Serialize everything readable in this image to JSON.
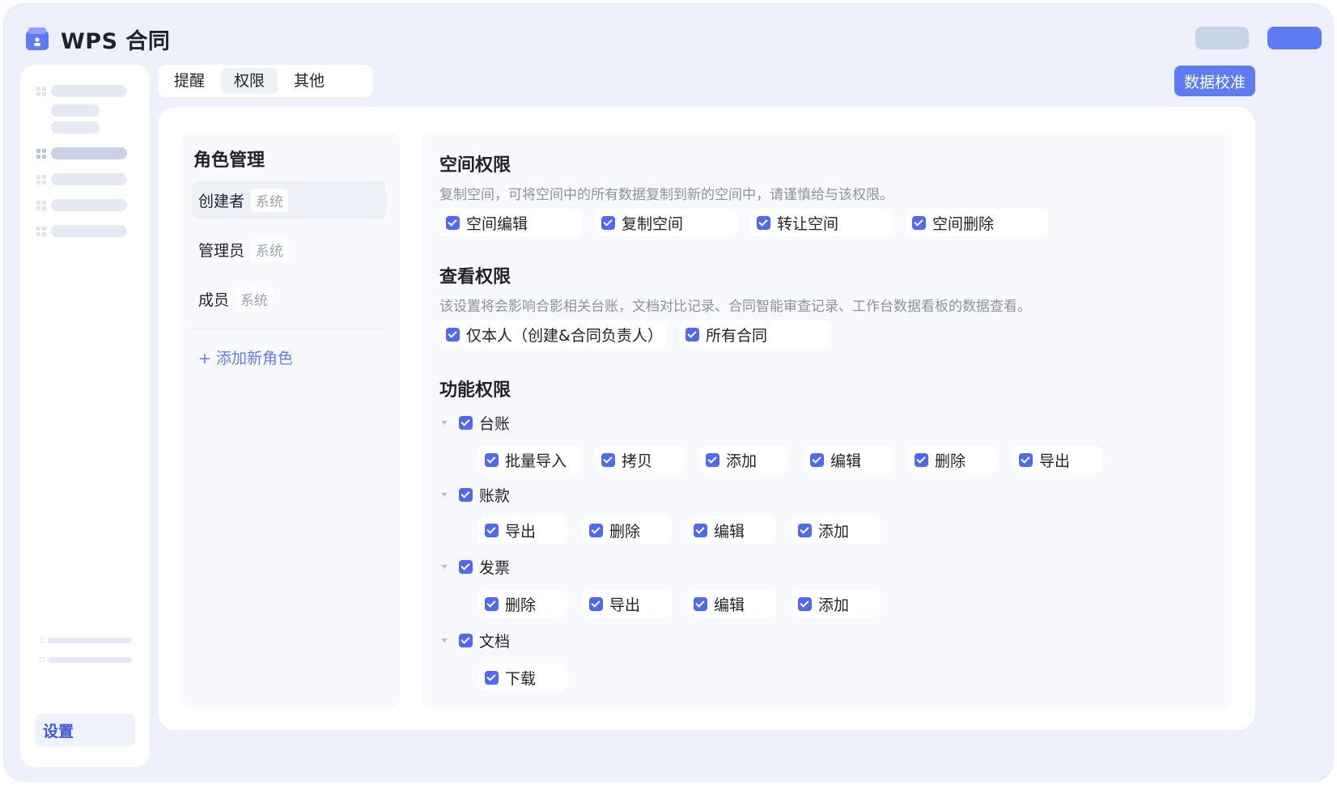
{
  "app": {
    "title": "WPS 合同"
  },
  "tabs": [
    {
      "label": "提醒"
    },
    {
      "label": "权限"
    },
    {
      "label": "其他"
    }
  ],
  "toolbar": {
    "primary_label": "数据校准"
  },
  "sidebar": {
    "settings_label": "设置"
  },
  "roles": {
    "title": "角色管理",
    "items": [
      {
        "name": "创建者",
        "tag": "系统"
      },
      {
        "name": "管理员",
        "tag": "系统"
      },
      {
        "name": "成员",
        "tag": "系统"
      }
    ],
    "add_label": "+ 添加新角色"
  },
  "space": {
    "title": "空间权限",
    "desc": "复制空间，可将空间中的所有数据复制到新的空间中，请谨慎给与该权限。",
    "options": [
      "空间编辑",
      "复制空间",
      "转让空间",
      "空间删除"
    ]
  },
  "view": {
    "title": "查看权限",
    "desc": "该设置将会影响合影相关台账，文档对比记录、合同智能审查记录、工作台数据看板的数据查看。",
    "options": [
      "仅本人（创建&合同负责人）",
      "所有合同"
    ]
  },
  "func": {
    "title": "功能权限",
    "groups": [
      {
        "label": "台账",
        "options": [
          "批量导入",
          "拷贝",
          "添加",
          "编辑",
          "删除",
          "导出"
        ]
      },
      {
        "label": "账款",
        "options": [
          "导出",
          "删除",
          "编辑",
          "添加"
        ]
      },
      {
        "label": "发票",
        "options": [
          "删除",
          "导出",
          "编辑",
          "添加"
        ]
      },
      {
        "label": "文档",
        "options": [
          "下载"
        ]
      }
    ]
  },
  "colors": {
    "accent": "#5f7bf4",
    "checkbox": "#4f6af0",
    "background": "#eef1fb"
  }
}
